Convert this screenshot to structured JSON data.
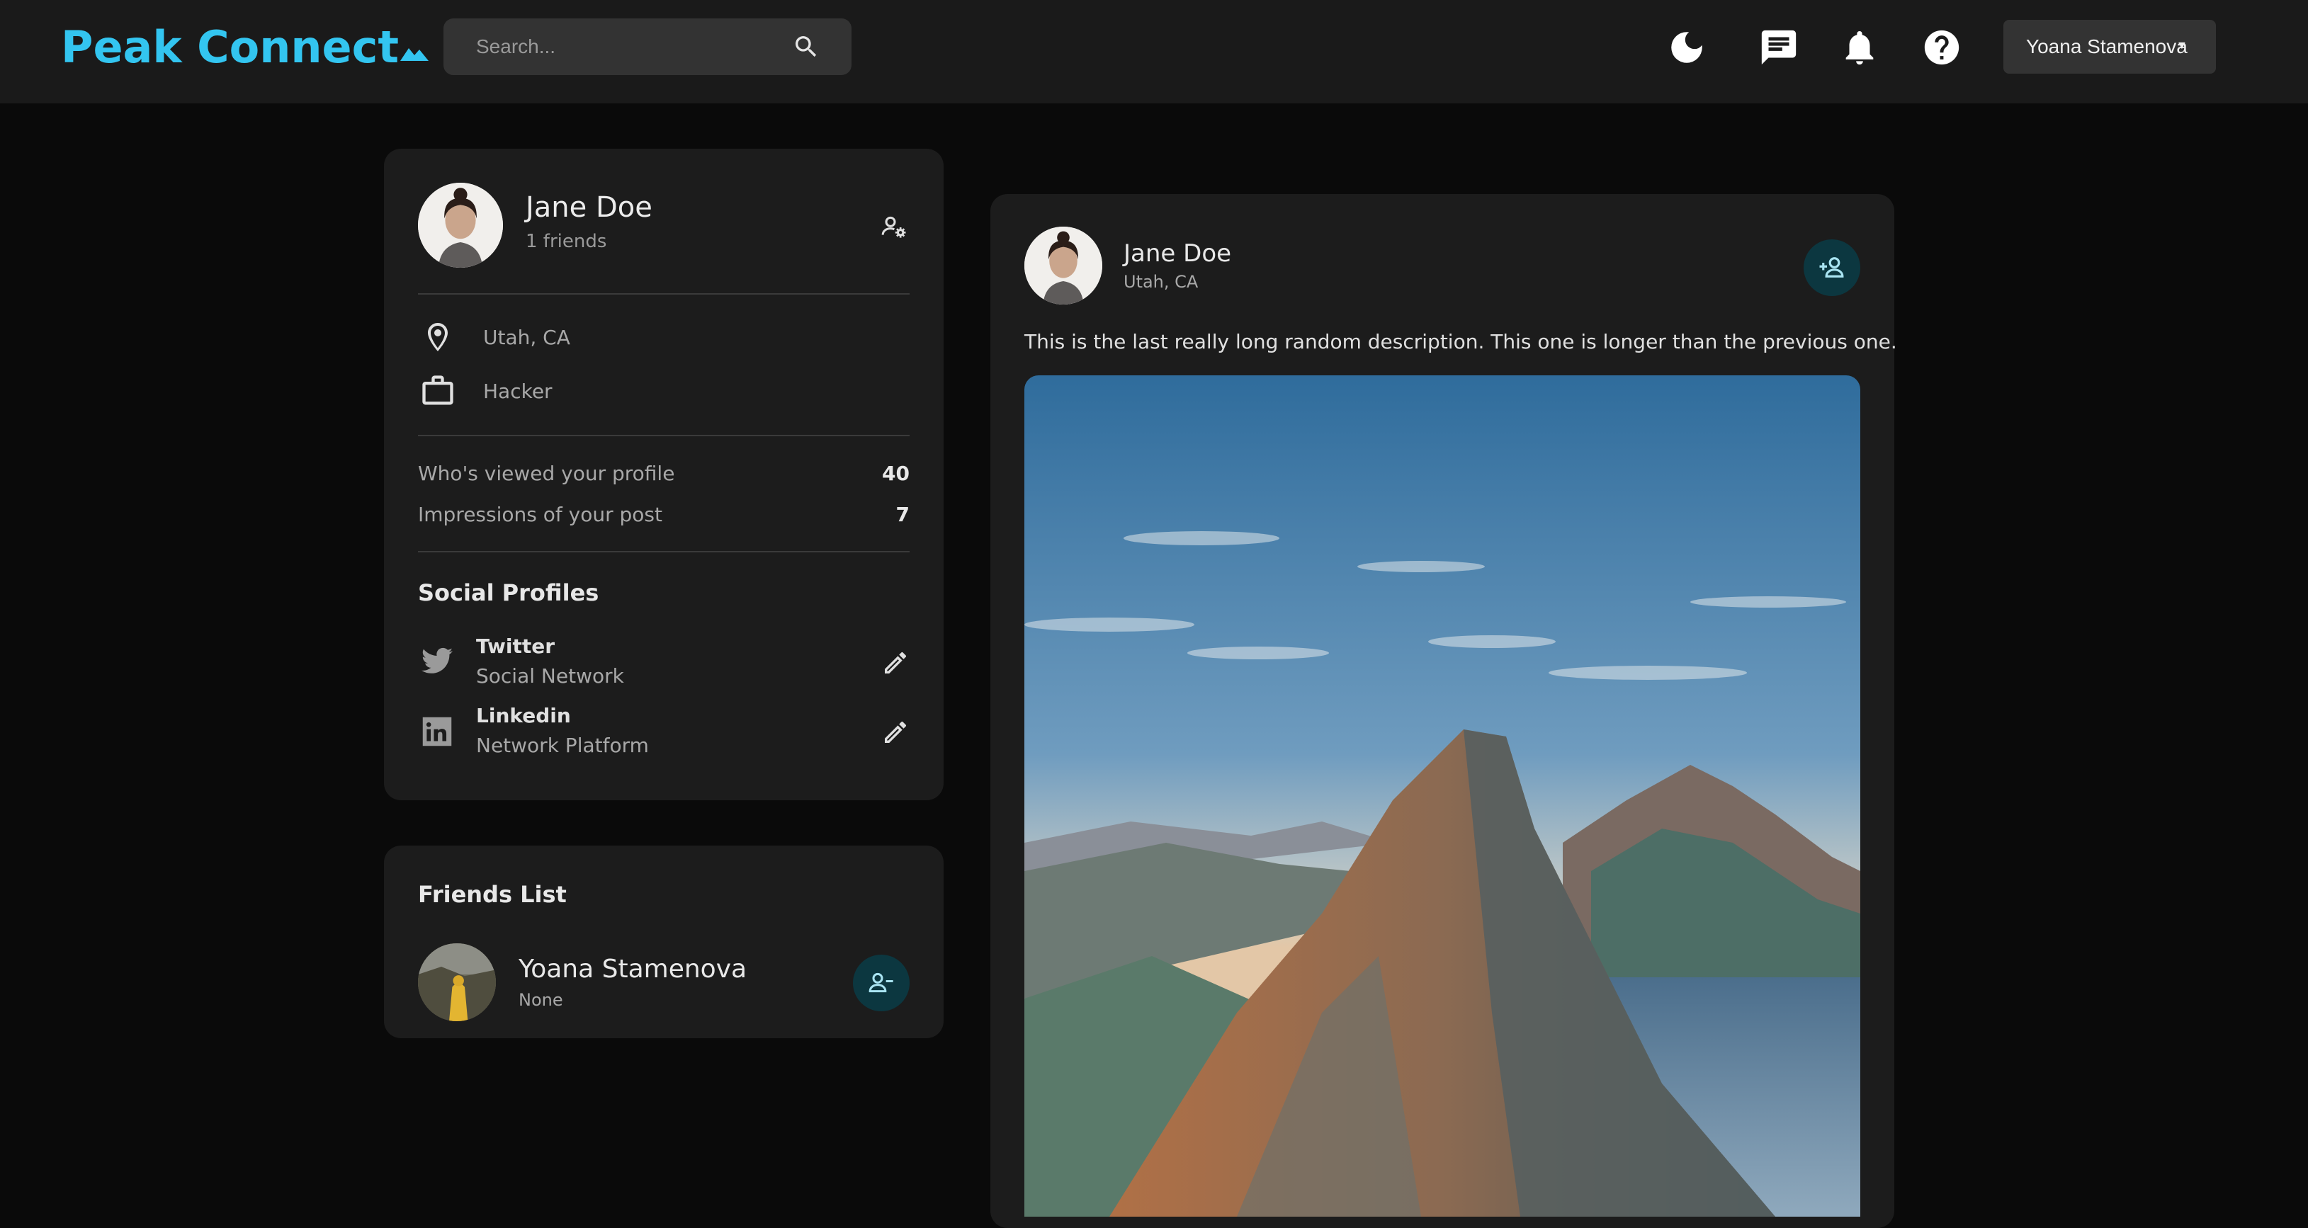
{
  "app": {
    "logo": "Peak Connect",
    "search_placeholder": "Search...",
    "icons": [
      "moon-icon",
      "chat-icon",
      "bell-icon",
      "help-icon"
    ],
    "current_user": "Yoana Stamenova",
    "accent_color": "#33c5f0"
  },
  "profile": {
    "name": "Jane Doe",
    "friends": "1 friends",
    "location": "Utah, CA",
    "occupation": "Hacker",
    "stats": [
      {
        "label": "Who's viewed your profile",
        "value": "40"
      },
      {
        "label": "Impressions of your post",
        "value": "7"
      }
    ],
    "social_heading": "Social Profiles",
    "socials": [
      {
        "name": "Twitter",
        "type": "Social Network",
        "icon": "twitter-icon"
      },
      {
        "name": "Linkedin",
        "type": "Network Platform",
        "icon": "linkedin-icon"
      }
    ]
  },
  "friends_list": {
    "heading": "Friends List",
    "friends": [
      {
        "name": "Yoana Stamenova",
        "subtitle": "None"
      }
    ]
  },
  "post": {
    "author": "Jane Doe",
    "location": "Utah, CA",
    "description": "This is the last really long random description. This one is longer than the previous one.",
    "image_subject": "mountain-peak-landscape"
  }
}
